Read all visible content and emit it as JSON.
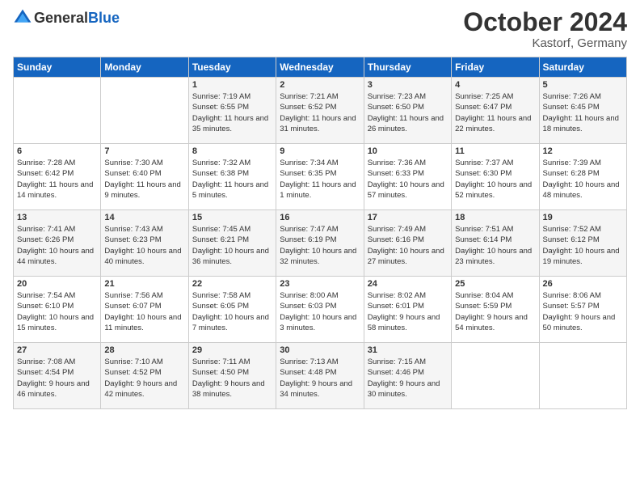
{
  "header": {
    "logo_general": "General",
    "logo_blue": "Blue",
    "month": "October 2024",
    "location": "Kastorf, Germany"
  },
  "days_of_week": [
    "Sunday",
    "Monday",
    "Tuesday",
    "Wednesday",
    "Thursday",
    "Friday",
    "Saturday"
  ],
  "weeks": [
    [
      {
        "day": "",
        "sunrise": "",
        "sunset": "",
        "daylight": ""
      },
      {
        "day": "",
        "sunrise": "",
        "sunset": "",
        "daylight": ""
      },
      {
        "day": "1",
        "sunrise": "Sunrise: 7:19 AM",
        "sunset": "Sunset: 6:55 PM",
        "daylight": "Daylight: 11 hours and 35 minutes."
      },
      {
        "day": "2",
        "sunrise": "Sunrise: 7:21 AM",
        "sunset": "Sunset: 6:52 PM",
        "daylight": "Daylight: 11 hours and 31 minutes."
      },
      {
        "day": "3",
        "sunrise": "Sunrise: 7:23 AM",
        "sunset": "Sunset: 6:50 PM",
        "daylight": "Daylight: 11 hours and 26 minutes."
      },
      {
        "day": "4",
        "sunrise": "Sunrise: 7:25 AM",
        "sunset": "Sunset: 6:47 PM",
        "daylight": "Daylight: 11 hours and 22 minutes."
      },
      {
        "day": "5",
        "sunrise": "Sunrise: 7:26 AM",
        "sunset": "Sunset: 6:45 PM",
        "daylight": "Daylight: 11 hours and 18 minutes."
      }
    ],
    [
      {
        "day": "6",
        "sunrise": "Sunrise: 7:28 AM",
        "sunset": "Sunset: 6:42 PM",
        "daylight": "Daylight: 11 hours and 14 minutes."
      },
      {
        "day": "7",
        "sunrise": "Sunrise: 7:30 AM",
        "sunset": "Sunset: 6:40 PM",
        "daylight": "Daylight: 11 hours and 9 minutes."
      },
      {
        "day": "8",
        "sunrise": "Sunrise: 7:32 AM",
        "sunset": "Sunset: 6:38 PM",
        "daylight": "Daylight: 11 hours and 5 minutes."
      },
      {
        "day": "9",
        "sunrise": "Sunrise: 7:34 AM",
        "sunset": "Sunset: 6:35 PM",
        "daylight": "Daylight: 11 hours and 1 minute."
      },
      {
        "day": "10",
        "sunrise": "Sunrise: 7:36 AM",
        "sunset": "Sunset: 6:33 PM",
        "daylight": "Daylight: 10 hours and 57 minutes."
      },
      {
        "day": "11",
        "sunrise": "Sunrise: 7:37 AM",
        "sunset": "Sunset: 6:30 PM",
        "daylight": "Daylight: 10 hours and 52 minutes."
      },
      {
        "day": "12",
        "sunrise": "Sunrise: 7:39 AM",
        "sunset": "Sunset: 6:28 PM",
        "daylight": "Daylight: 10 hours and 48 minutes."
      }
    ],
    [
      {
        "day": "13",
        "sunrise": "Sunrise: 7:41 AM",
        "sunset": "Sunset: 6:26 PM",
        "daylight": "Daylight: 10 hours and 44 minutes."
      },
      {
        "day": "14",
        "sunrise": "Sunrise: 7:43 AM",
        "sunset": "Sunset: 6:23 PM",
        "daylight": "Daylight: 10 hours and 40 minutes."
      },
      {
        "day": "15",
        "sunrise": "Sunrise: 7:45 AM",
        "sunset": "Sunset: 6:21 PM",
        "daylight": "Daylight: 10 hours and 36 minutes."
      },
      {
        "day": "16",
        "sunrise": "Sunrise: 7:47 AM",
        "sunset": "Sunset: 6:19 PM",
        "daylight": "Daylight: 10 hours and 32 minutes."
      },
      {
        "day": "17",
        "sunrise": "Sunrise: 7:49 AM",
        "sunset": "Sunset: 6:16 PM",
        "daylight": "Daylight: 10 hours and 27 minutes."
      },
      {
        "day": "18",
        "sunrise": "Sunrise: 7:51 AM",
        "sunset": "Sunset: 6:14 PM",
        "daylight": "Daylight: 10 hours and 23 minutes."
      },
      {
        "day": "19",
        "sunrise": "Sunrise: 7:52 AM",
        "sunset": "Sunset: 6:12 PM",
        "daylight": "Daylight: 10 hours and 19 minutes."
      }
    ],
    [
      {
        "day": "20",
        "sunrise": "Sunrise: 7:54 AM",
        "sunset": "Sunset: 6:10 PM",
        "daylight": "Daylight: 10 hours and 15 minutes."
      },
      {
        "day": "21",
        "sunrise": "Sunrise: 7:56 AM",
        "sunset": "Sunset: 6:07 PM",
        "daylight": "Daylight: 10 hours and 11 minutes."
      },
      {
        "day": "22",
        "sunrise": "Sunrise: 7:58 AM",
        "sunset": "Sunset: 6:05 PM",
        "daylight": "Daylight: 10 hours and 7 minutes."
      },
      {
        "day": "23",
        "sunrise": "Sunrise: 8:00 AM",
        "sunset": "Sunset: 6:03 PM",
        "daylight": "Daylight: 10 hours and 3 minutes."
      },
      {
        "day": "24",
        "sunrise": "Sunrise: 8:02 AM",
        "sunset": "Sunset: 6:01 PM",
        "daylight": "Daylight: 9 hours and 58 minutes."
      },
      {
        "day": "25",
        "sunrise": "Sunrise: 8:04 AM",
        "sunset": "Sunset: 5:59 PM",
        "daylight": "Daylight: 9 hours and 54 minutes."
      },
      {
        "day": "26",
        "sunrise": "Sunrise: 8:06 AM",
        "sunset": "Sunset: 5:57 PM",
        "daylight": "Daylight: 9 hours and 50 minutes."
      }
    ],
    [
      {
        "day": "27",
        "sunrise": "Sunrise: 7:08 AM",
        "sunset": "Sunset: 4:54 PM",
        "daylight": "Daylight: 9 hours and 46 minutes."
      },
      {
        "day": "28",
        "sunrise": "Sunrise: 7:10 AM",
        "sunset": "Sunset: 4:52 PM",
        "daylight": "Daylight: 9 hours and 42 minutes."
      },
      {
        "day": "29",
        "sunrise": "Sunrise: 7:11 AM",
        "sunset": "Sunset: 4:50 PM",
        "daylight": "Daylight: 9 hours and 38 minutes."
      },
      {
        "day": "30",
        "sunrise": "Sunrise: 7:13 AM",
        "sunset": "Sunset: 4:48 PM",
        "daylight": "Daylight: 9 hours and 34 minutes."
      },
      {
        "day": "31",
        "sunrise": "Sunrise: 7:15 AM",
        "sunset": "Sunset: 4:46 PM",
        "daylight": "Daylight: 9 hours and 30 minutes."
      },
      {
        "day": "",
        "sunrise": "",
        "sunset": "",
        "daylight": ""
      },
      {
        "day": "",
        "sunrise": "",
        "sunset": "",
        "daylight": ""
      }
    ]
  ]
}
